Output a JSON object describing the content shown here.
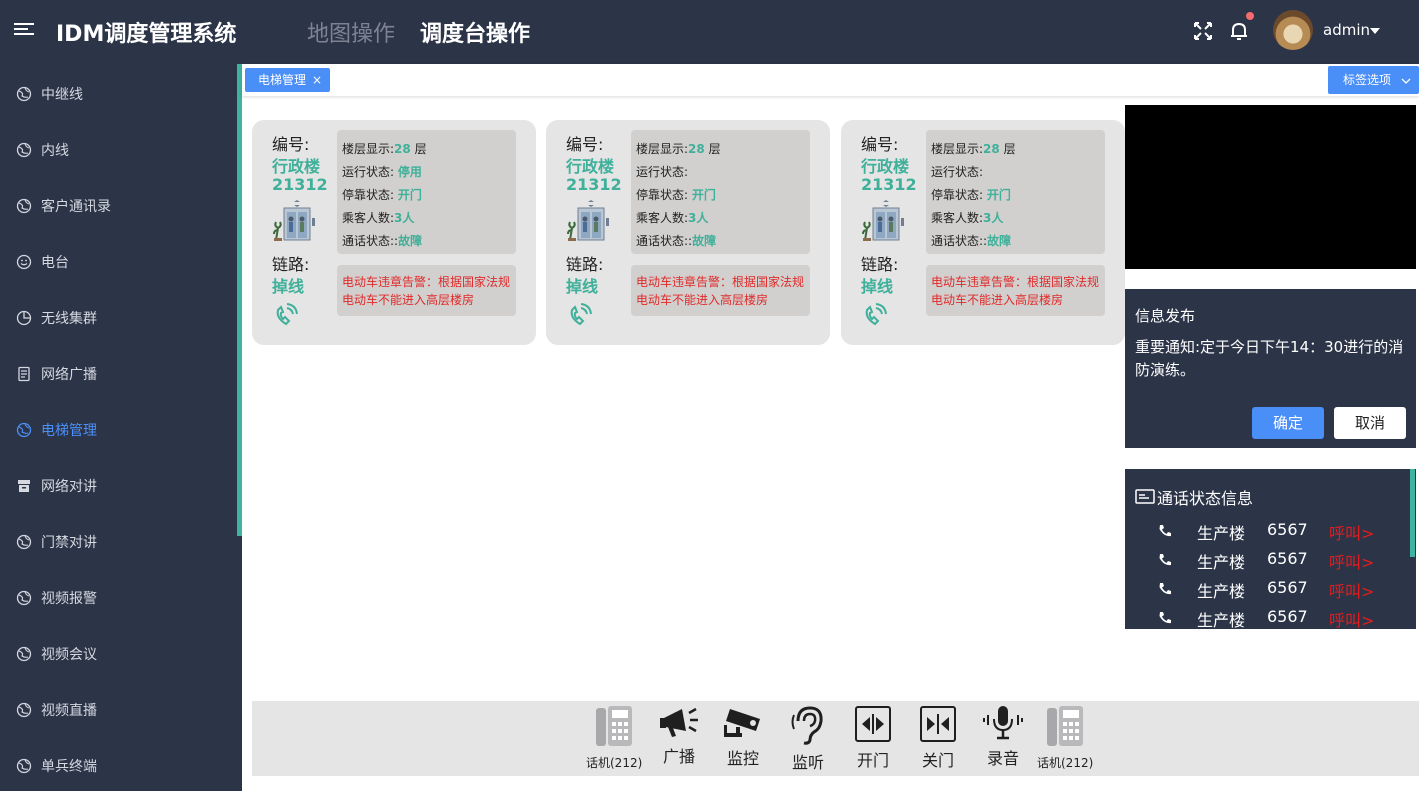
{
  "app": {
    "title": "IDM调度管理系统"
  },
  "header": {
    "nav_tabs": [
      "地图操作",
      "调度台操作"
    ],
    "user": "admin"
  },
  "sidebar": {
    "items": [
      {
        "label": "中继线",
        "icon": "globe-icon"
      },
      {
        "label": "内线",
        "icon": "globe-icon"
      },
      {
        "label": "客户通讯录",
        "icon": "globe-icon"
      },
      {
        "label": "电台",
        "icon": "smile-icon"
      },
      {
        "label": "无线集群",
        "icon": "pie-chart-icon"
      },
      {
        "label": "网络广播",
        "icon": "document-icon"
      },
      {
        "label": "电梯管理",
        "icon": "globe-icon",
        "active": true
      },
      {
        "label": "网络对讲",
        "icon": "archive-icon"
      },
      {
        "label": "门禁对讲",
        "icon": "globe-icon"
      },
      {
        "label": "视频报警",
        "icon": "globe-icon"
      },
      {
        "label": "视频会议",
        "icon": "globe-icon"
      },
      {
        "label": "视频直播",
        "icon": "globe-icon"
      },
      {
        "label": "单兵终端",
        "icon": "globe-icon"
      }
    ]
  },
  "tags": {
    "open_tab": "电梯管理",
    "close_symbol": "×",
    "options_label": "标签选项"
  },
  "cards": [
    {
      "id_label": "编号:",
      "building": "行政楼",
      "id": "21312",
      "link_label": "链路:",
      "link_status": "掉线",
      "floor_label": "楼层显示:",
      "floor": "28",
      "floor_unit": "层",
      "run_label": "运行状态:",
      "run_status": "停用",
      "dock_label": "停靠状态:",
      "dock_status": "开门",
      "pax_label": "乘客人数:",
      "pax": "3人",
      "call_label": "通话状态::",
      "call_status": "故障",
      "warning": "电动车违章告警：根据国家法规电动车不能进入高层楼房"
    },
    {
      "id_label": "编号:",
      "building": "行政楼",
      "id": "21312",
      "link_label": "链路:",
      "link_status": "掉线",
      "floor_label": "楼层显示:",
      "floor": "28",
      "floor_unit": "层",
      "run_label": "运行状态:",
      "run_status": "",
      "dock_label": "停靠状态:",
      "dock_status": "开门",
      "pax_label": "乘客人数:",
      "pax": "3人",
      "call_label": "通话状态::",
      "call_status": "故障",
      "warning": "电动车违章告警：根据国家法规电动车不能进入高层楼房"
    },
    {
      "id_label": "编号:",
      "building": "行政楼",
      "id": "21312",
      "link_label": "链路:",
      "link_status": "掉线",
      "floor_label": "楼层显示:",
      "floor": "28",
      "floor_unit": "层",
      "run_label": "运行状态:",
      "run_status": "",
      "dock_label": "停靠状态:",
      "dock_status": "开门",
      "pax_label": "乘客人数:",
      "pax": "3人",
      "call_label": "通话状态::",
      "call_status": "故障",
      "warning": "电动车违章告警：根据国家法规电动车不能进入高层楼房"
    }
  ],
  "notice": {
    "title": "信息发布",
    "body": "重要通知:定于今日下午14：30进行的消防演练。",
    "ok": "确定",
    "cancel": "取消"
  },
  "calls": {
    "title": "通话状态信息",
    "rows": [
      {
        "building": "生产楼",
        "number": "6567",
        "status": "呼叫>"
      },
      {
        "building": "生产楼",
        "number": "6567",
        "status": "呼叫>"
      },
      {
        "building": "生产楼",
        "number": "6567",
        "status": "呼叫>"
      },
      {
        "building": "生产楼",
        "number": "6567",
        "status": "呼叫>"
      }
    ]
  },
  "toolbar": {
    "items": [
      {
        "label": "话机(212)",
        "icon": "desk-phone-icon"
      },
      {
        "label": "广播",
        "icon": "megaphone-icon"
      },
      {
        "label": "监控",
        "icon": "cctv-camera-icon"
      },
      {
        "label": "监听",
        "icon": "ear-icon"
      },
      {
        "label": "开门",
        "icon": "door-open-icon"
      },
      {
        "label": "关门",
        "icon": "door-close-icon"
      },
      {
        "label": "录音",
        "icon": "microphone-icon"
      },
      {
        "label": "话机(212)",
        "icon": "desk-phone-icon"
      }
    ]
  },
  "colors": {
    "nav_bg": "#2c3448",
    "accent": "#4a8ef7",
    "green": "#3fb09a",
    "alert": "#e02a2a"
  }
}
